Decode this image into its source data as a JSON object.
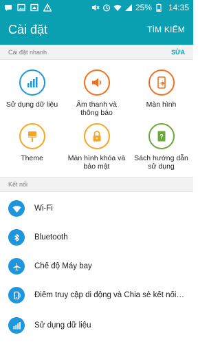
{
  "status_bar": {
    "battery": "25%",
    "time": "14:35",
    "icons_left": [
      "message-icon",
      "image-icon",
      "screenshot-icon",
      "warning-icon"
    ],
    "icons_right": [
      "mute-icon",
      "alarm-icon",
      "wifi-icon",
      "signal-icon",
      "battery-icon"
    ]
  },
  "app_bar": {
    "title": "Cài đặt",
    "action": "TÌM KIẾM"
  },
  "quick_settings": {
    "header": "Cài đặt nhanh",
    "edit": "SỬA",
    "tiles": [
      {
        "label": "Sử dụng dữ liệu",
        "icon": "data-usage-icon",
        "color": "#1e96de"
      },
      {
        "label": "Âm thanh và thông báo",
        "icon": "sound-icon",
        "color": "#f0701f"
      },
      {
        "label": "Màn hình",
        "icon": "display-icon",
        "color": "#f0701f"
      },
      {
        "label": "Theme",
        "icon": "theme-icon",
        "color": "#f5a623"
      },
      {
        "label": "Màn hình khóa và bảo mật",
        "icon": "lock-icon",
        "color": "#f5a623"
      },
      {
        "label": "Sách hướng dẫn sử dụng",
        "icon": "user-manual-icon",
        "color": "#6aa83a"
      }
    ]
  },
  "connections": {
    "header": "Kết nối",
    "items": [
      {
        "label": "Wi-Fi",
        "icon": "wifi-icon"
      },
      {
        "label": "Bluetooth",
        "icon": "bluetooth-icon"
      },
      {
        "label": "Chế độ Máy bay",
        "icon": "airplane-icon"
      },
      {
        "label": "Điểm truy cập di động và Chia sẻ kết nối i...",
        "icon": "hotspot-icon"
      },
      {
        "label": "Sử dụng dữ liệu",
        "icon": "data-usage-icon"
      }
    ]
  },
  "colors": {
    "accent": "#0aa0b2",
    "list_icon": "#1e96de"
  }
}
